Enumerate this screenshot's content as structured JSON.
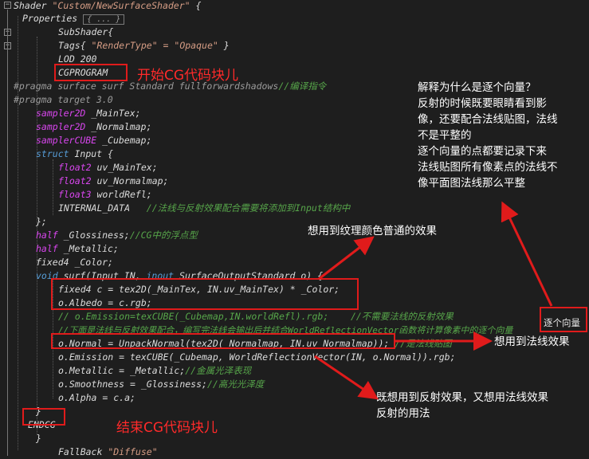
{
  "code": {
    "l1_a": "Shader ",
    "l1_b": "\"Custom/NewSurfaceShader\"",
    "l1_c": " {",
    "l2": "Properties",
    "l2_collapsed": "{ ... }",
    "l3": "SubShader{",
    "l4_a": "Tags{ ",
    "l4_b": "\"RenderType\" = \"Opaque\"",
    "l4_c": " }",
    "l5": "LOD 200",
    "l6": "CGPROGRAM",
    "l7_a": "#pragma surface surf Standard fullforwardshadows",
    "l7_b": "//编译指令",
    "l8": "#pragma target 3.0",
    "l9_a": "sampler2D",
    "l9_b": " _MainTex;",
    "l10_a": "sampler2D",
    "l10_b": " _Normalmap;",
    "l11_a": "samplerCUBE",
    "l11_b": " _Cubemap;",
    "l12_a": "struct",
    "l12_b": " Input {",
    "l13_a": "float2",
    "l13_b": " uv_MainTex;",
    "l14_a": "float2",
    "l14_b": " uv_Normalmap;",
    "l15_a": "float3",
    "l15_b": " worldRefl;",
    "l16_a": "INTERNAL_DATA",
    "l16_b": "   //法线与反射效果配合需要将添加到Input结构中",
    "l17": "};",
    "l18_a": "half",
    "l18_b": " _Glossiness;",
    "l18_c": "//CG中的浮点型",
    "l19_a": "half",
    "l19_b": " _Metallic;",
    "l20": "fixed4 _Color;",
    "l21_a": "void",
    "l21_b": " surf(Input IN, ",
    "l21_c": "inout",
    "l21_d": " SurfaceOutputStandard o) {",
    "l22": "fixed4 c = tex2D(_MainTex, IN.uv_MainTex) * _Color;",
    "l23": "o.Albedo = c.rgb;",
    "l24": "// o.Emission=texCUBE(_Cubemap,IN.worldRefl).rgb;    //不需要法线的反射效果",
    "l25": "//下面是法线与反射效果配合，编写完法线会输出后并结合WorldReflectionVector函数将计算像素中的逐个向量",
    "l26_a": "o.Normal = UnpackNormal(tex2D(_Normalmap, IN.uv_Normalmap));",
    "l26_b": "//是法线贴图",
    "l27": "o.Emission = texCUBE(_Cubemap, WorldReflectionVector(IN, o.Normal)).rgb;",
    "l28_a": "o.Metallic = _Metallic;",
    "l28_b": "//金属光泽表现",
    "l29_a": "o.Smoothness = _Glossiness;",
    "l29_b": "//高光光泽度",
    "l30": "o.Alpha = c.a;",
    "l31": "}",
    "l32": "ENDCG",
    "l33": "}",
    "l34_a": "FallBack ",
    "l34_b": "\"Diffuse\"",
    "l35": "}"
  },
  "annotations": {
    "start_cg": "开始CG代码块儿",
    "end_cg": "结束CG代码块儿",
    "explain": "解释为什么是逐个向量？\n反射的时候既要眼睛看到影\n像，还要配合法线贴图，法线\n不是平整的\n逐个向量的点都要记录下来\n法线贴图所有像素点的法线不\n像平面图法线那么平整",
    "texture_effect": "想用到纹理颜色普通的效果",
    "normal_effect": "想用到法线效果",
    "reflect_normal": "既想用到反射效果，又想用法线效果\n反射的用法",
    "per_vector": "逐个向量"
  },
  "colors": {
    "background": "#1e1e1e",
    "keyword": "#569cd6",
    "type": "#d946ef",
    "string": "#d69d85",
    "comment": "#57a64a",
    "annotation_red": "#e01b1b"
  }
}
